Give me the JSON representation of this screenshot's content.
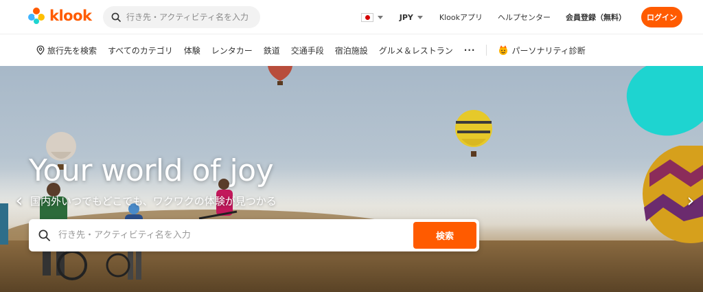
{
  "header": {
    "logo_text": "klook",
    "search_placeholder": "行き先・アクティビティ名を入力",
    "language": "",
    "currency": "JPY",
    "app_link": "Klookアプリ",
    "help_link": "ヘルプセンター",
    "signup_link": "会員登録（無料）",
    "login_label": "ログイン"
  },
  "nav": {
    "items": [
      {
        "label": "旅行先を検索",
        "icon": "location-pin-icon"
      },
      {
        "label": "すべてのカテゴリ"
      },
      {
        "label": "体験"
      },
      {
        "label": "レンタカー"
      },
      {
        "label": "鉄道"
      },
      {
        "label": "交通手段"
      },
      {
        "label": "宿泊施設"
      },
      {
        "label": "グルメ＆レストラン"
      }
    ],
    "more": "···",
    "personality": "パーソナリティ診断"
  },
  "hero": {
    "title": "Your world of joy",
    "subtitle": "国内外いつでもどこでも、ワクワクの体験が見つかる",
    "search_placeholder": "行き先・アクティビティ名を入力",
    "search_button": "検索",
    "prev_arrow": "‹",
    "next_arrow": "›"
  },
  "colors": {
    "brand_orange": "#ff5b00",
    "accent_teal": "#1ed4d0"
  }
}
